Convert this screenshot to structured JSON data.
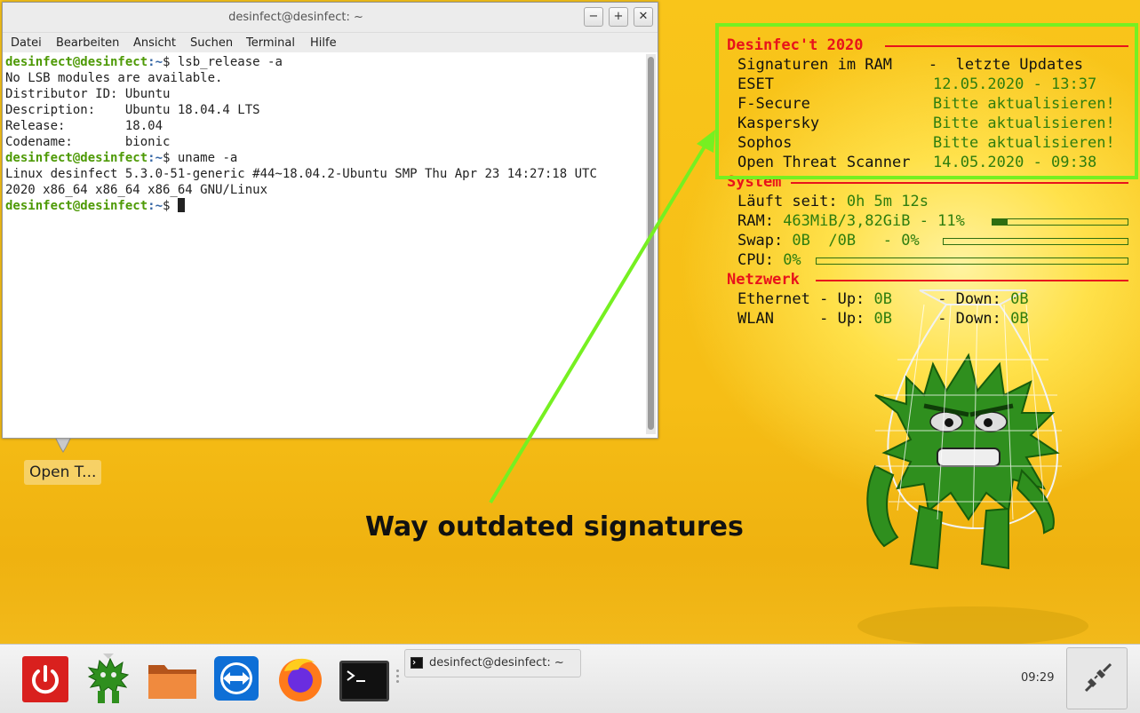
{
  "terminal": {
    "title": "desinfect@desinfect: ~",
    "menu": [
      "Datei",
      "Bearbeiten",
      "Ansicht",
      "Suchen",
      "Terminal",
      "Hilfe"
    ],
    "prompt_user": "desinfect@desinfect",
    "prompt_path": ":~",
    "prompt_symbol": "$",
    "cmd1": " lsb_release -a",
    "output1": [
      "No LSB modules are available.",
      "Distributor ID: Ubuntu",
      "Description:    Ubuntu 18.04.4 LTS",
      "Release:        18.04",
      "Codename:       bionic"
    ],
    "cmd2": " uname -a",
    "output2": [
      "Linux desinfect 5.3.0-51-generic #44~18.04.2-Ubuntu SMP Thu Apr 23 14:27:18 UTC",
      "2020 x86_64 x86_64 x86_64 GNU/Linux"
    ],
    "buttons": {
      "minimize": "−",
      "maximize": "+",
      "close": "✕"
    }
  },
  "desktop_icon": {
    "label": "Open T..."
  },
  "conky": {
    "title": "Desinfec't 2020",
    "sig_header": "Signaturen im RAM    -  letzte Updates",
    "scanners": [
      {
        "name": "ESET",
        "status": "12.05.2020 - 13:37"
      },
      {
        "name": "F-Secure",
        "status": "Bitte aktualisieren!"
      },
      {
        "name": "Kaspersky",
        "status": "Bitte aktualisieren!"
      },
      {
        "name": "Sophos",
        "status": "Bitte aktualisieren!"
      },
      {
        "name": "Open Threat Scanner",
        "status": "14.05.2020 - 09:38"
      }
    ],
    "system_title": "System",
    "uptime_label": "Läuft seit: ",
    "uptime_value": "0h 5m 12s",
    "ram_label": "RAM: ",
    "ram_value": "463MiB/3,82GiB - 11%",
    "ram_fraction": 0.11,
    "swap_label": "Swap: ",
    "swap_value": "0B  /0B   - 0%",
    "swap_fraction": 0.0,
    "cpu_label": "CPU: ",
    "cpu_value": "0%",
    "cpu_fraction": 0.0,
    "network_title": "Netzwerk",
    "eth_label": "Ethernet - Up: ",
    "eth_up": "0B",
    "eth_mid": "     - Down: ",
    "eth_down": "0B",
    "wlan_label": "WLAN     - Up: ",
    "wlan_up": "0B",
    "wlan_mid": "     - Down: ",
    "wlan_down": "0B"
  },
  "annotation": {
    "text": "Way outdated signatures",
    "color": "#76f021"
  },
  "taskbar": {
    "launchers": [
      "power-icon",
      "desinfect-mascot-icon",
      "folder-icon",
      "teamviewer-icon",
      "firefox-icon",
      "terminal-icon"
    ],
    "task_label": "desinfect@desinfect: ~",
    "clock": "09:29",
    "network_icon": "network-disconnected-icon"
  },
  "colors": {
    "accent_red": "#e8131b",
    "value_green": "#2e7d0e",
    "prompt_green": "#4e9a06",
    "prompt_blue": "#3465a4"
  }
}
